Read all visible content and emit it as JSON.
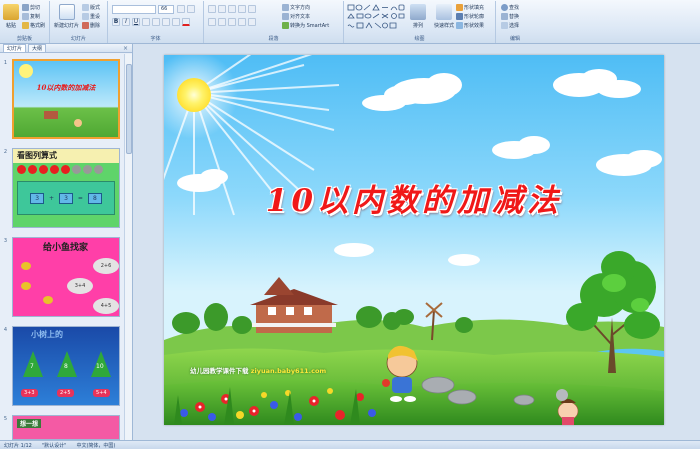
{
  "ribbon": {
    "clipboard": {
      "paste": "粘贴",
      "cut": "剪切",
      "copy": "复制",
      "format_painter": "格式刷",
      "label": "剪贴板"
    },
    "slides": {
      "new_slide": "新建幻灯片",
      "layout": "版式",
      "reset": "重设",
      "delete": "删除",
      "label": "幻灯片"
    },
    "font": {
      "size": "66",
      "label": "字体"
    },
    "paragraph": {
      "text_direction": "文字方向",
      "align_text": "对齐文本",
      "smartart": "转换为 SmartArt",
      "label": "段落"
    },
    "drawing": {
      "arrange": "排列",
      "quick_styles": "快速样式",
      "shape_fill": "形状填充",
      "shape_outline": "形状轮廓",
      "shape_effects": "形状效果",
      "label": "绘图"
    },
    "editing": {
      "find": "查找",
      "replace": "替换",
      "select": "选择",
      "label": "编辑"
    }
  },
  "pane": {
    "tabs": [
      "幻灯片",
      "大纲"
    ],
    "close": "×",
    "thumbnails": [
      {
        "num": "1",
        "title": "10以内数的加减法"
      },
      {
        "num": "2",
        "title": "看图列算式",
        "eq": [
          "3",
          "+",
          "3",
          "=",
          "8"
        ]
      },
      {
        "num": "3",
        "title": "给小鱼找家",
        "clouds": [
          "2+6",
          "3+4",
          "4+5"
        ]
      },
      {
        "num": "4",
        "title": "小树上的",
        "nums": [
          "7",
          "8",
          "10"
        ],
        "hearts": [
          "3+3",
          "2+5",
          "5+4"
        ]
      },
      {
        "num": "5",
        "title": "想一想"
      }
    ]
  },
  "slide": {
    "title": "10以内数的加减法",
    "footer_label": "幼儿园教学课件下载",
    "footer_url": "ziyuan.baby611.com"
  },
  "status": {
    "slide_info": "幻灯片 1/12",
    "theme": "\"默认设计\"",
    "language": "中文(简体，中国)"
  },
  "colors": {
    "title": "#f01818",
    "sky": "#4fbdf5",
    "grass": "#5dbb3a",
    "thumb_pink": "#ff3fa8"
  }
}
